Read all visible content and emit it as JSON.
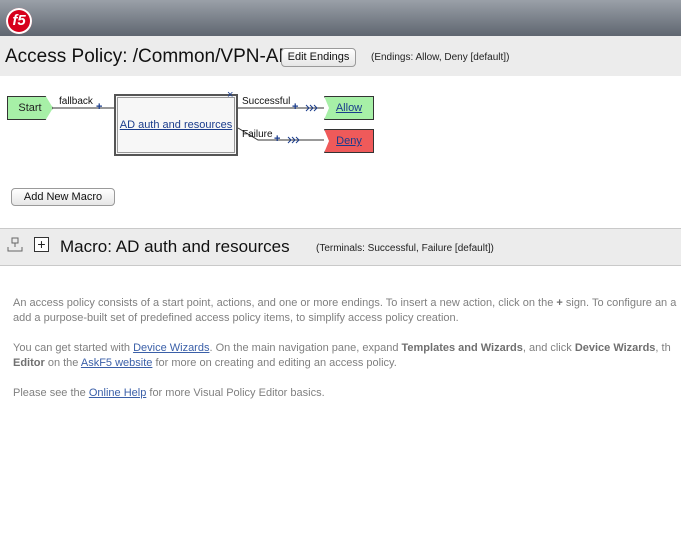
{
  "brand": {
    "logo_text": "f5",
    "logo_color": "#d6001c"
  },
  "header": {
    "title": "Access Policy: /Common/VPN-AP",
    "edit_endings_label": "Edit Endings",
    "endings_note": "(Endings: Allow, Deny [default])"
  },
  "flow": {
    "start_label": "Start",
    "fallback_label": "fallback",
    "macro_box_label": "AD auth and resources",
    "successful_label": "Successful",
    "failure_label": "Failure",
    "allow_label": "Allow",
    "deny_label": "Deny",
    "plus_symbol": "+",
    "close_symbol": "×",
    "colors": {
      "start": "#a7f0a7",
      "allow": "#a7f0a7",
      "deny": "#ef5a5a"
    }
  },
  "add_macro_label": "Add New Macro",
  "macro": {
    "expand_symbol": "+",
    "title": "Macro: AD auth and resources",
    "terminals_note": "(Terminals: Successful, Failure [default])"
  },
  "help": {
    "p1_line1_a": "An access policy consists of a start point, actions, and one or more endings. To insert a new action, click on the ",
    "p1_plus": "+",
    "p1_line1_b": " sign. To configure an a",
    "p1_line2": "add a purpose-built set of predefined access policy items, to simplify access policy creation.",
    "p2_a": "You can get started with ",
    "p2_link1": "Device Wizards",
    "p2_b": ". On the main navigation pane, expand ",
    "p2_bold1": "Templates and Wizards",
    "p2_c": ", and click ",
    "p2_bold2": "Device Wizards",
    "p2_d": ", th",
    "p2_bold3": "Editor",
    "p2_e": " on the ",
    "p2_link2": "AskF5 website",
    "p2_f": " for more on creating and editing an access policy.",
    "p3_a": "Please see the ",
    "p3_link": "Online Help",
    "p3_b": " for more Visual Policy Editor basics."
  }
}
